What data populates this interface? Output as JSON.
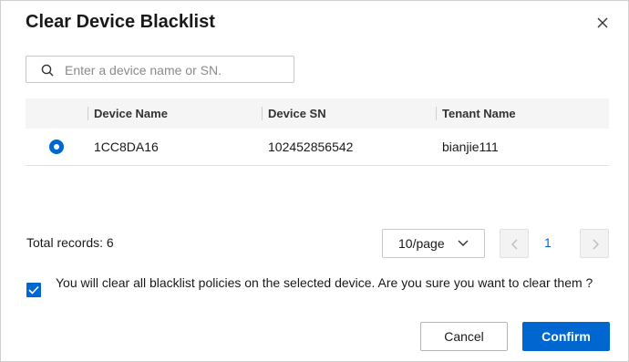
{
  "dialog": {
    "title": "Clear Device Blacklist",
    "close_icon": "close-icon"
  },
  "search": {
    "placeholder": "Enter a device name or SN.",
    "value": "",
    "icon": "search-icon"
  },
  "table": {
    "columns": [
      "Device Name",
      "Device SN",
      "Tenant Name"
    ],
    "rows": [
      {
        "selected": true,
        "device_name": "1CC8DA16",
        "device_sn": "102452856542",
        "tenant_name": "bianjie111"
      }
    ]
  },
  "pagination": {
    "total_label": "Total records: 6",
    "page_size": "10/page",
    "current_page": "1",
    "prev_icon": "chevron-left-icon",
    "next_icon": "chevron-right-icon"
  },
  "confirmation": {
    "checked": true,
    "text": "You will clear all blacklist policies on the selected device. Are you sure you want to clear them ?"
  },
  "footer": {
    "cancel_label": "Cancel",
    "confirm_label": "Confirm"
  },
  "colors": {
    "primary": "#0067d1",
    "header_bg": "#f5f5f5"
  }
}
